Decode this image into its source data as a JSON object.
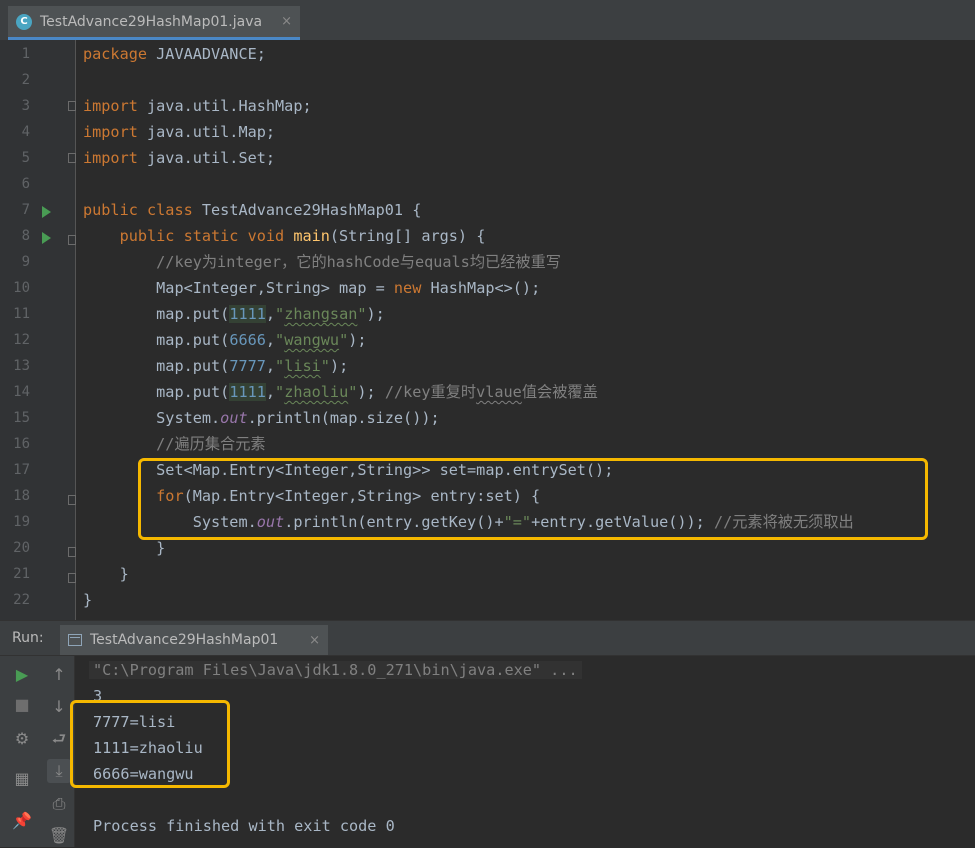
{
  "editor_tab": {
    "title": "TestAdvance29HashMap01.java",
    "icon": "class-icon",
    "close": "×"
  },
  "code": {
    "line_numbers": [
      "1",
      "2",
      "3",
      "4",
      "5",
      "6",
      "7",
      "8",
      "9",
      "10",
      "11",
      "12",
      "13",
      "14",
      "15",
      "16",
      "17",
      "18",
      "19",
      "20",
      "21",
      "22"
    ],
    "l1": {
      "kw": "package",
      "rest": " JAVAADVANCE;"
    },
    "l3": {
      "kw": "import",
      "rest": " java.util.HashMap;"
    },
    "l4": {
      "kw": "import",
      "rest": " java.util.Map;"
    },
    "l5": {
      "kw": "import",
      "rest": " java.util.Set;"
    },
    "l7": {
      "kw1": "public",
      "kw2": " class",
      "rest": " TestAdvance29HashMap01 {"
    },
    "l8": {
      "indent": "    ",
      "kw": "public static void",
      "fn": " main",
      "rest": "(String[] args) {"
    },
    "l9": {
      "indent": "        ",
      "comment": "//key为integer，它的hashCode与equals均已经被重写"
    },
    "l10": {
      "indent": "        ",
      "a": "Map<Integer,String> map = ",
      "kw": "new",
      "b": " HashMap<>();"
    },
    "l11": {
      "indent": "        ",
      "a": "map.put(",
      "num": "1111",
      "b": ",",
      "q1": "\"",
      "str": "zhangsan",
      "q2": "\"",
      "c": ");"
    },
    "l12": {
      "indent": "        ",
      "a": "map.put(",
      "num": "6666",
      "b": ",",
      "q1": "\"",
      "str": "wangwu",
      "q2": "\"",
      "c": ");"
    },
    "l13": {
      "indent": "        ",
      "a": "map.put(",
      "num": "7777",
      "b": ",",
      "q1": "\"",
      "str": "lisi",
      "q2": "\"",
      "c": ");"
    },
    "l14": {
      "indent": "        ",
      "a": "map.put(",
      "num": "1111",
      "b": ",",
      "q1": "\"",
      "str": "zhaoliu",
      "q2": "\"",
      "c": "); ",
      "comment1": "//key重复时",
      "comment_w": "vlaue",
      "comment2": "值会被覆盖"
    },
    "l15": {
      "indent": "        ",
      "a": "System.",
      "field": "out",
      "b": ".println(map.size());"
    },
    "l16": {
      "indent": "        ",
      "comment": "//遍历集合元素"
    },
    "l17": {
      "indent": "        ",
      "a": "Set<Map.Entry<Integer,String>> set=map.entrySet();"
    },
    "l18": {
      "indent": "        ",
      "kw": "for",
      "a": "(Map.Entry<Integer,String> entry:set) {"
    },
    "l19": {
      "indent": "            ",
      "a": "System.",
      "field": "out",
      "b": ".println(entry.getKey()+",
      "str": "\"=\"",
      "c": "+entry.getValue()); ",
      "comment": "//元素将被无须取出"
    },
    "l20": {
      "indent": "        ",
      "a": "}"
    },
    "l21": {
      "indent": "    ",
      "a": "}"
    },
    "l22": {
      "indent": "",
      "a": "}"
    }
  },
  "run_panel": {
    "label": "Run:",
    "tab_title": "TestAdvance29HashMap01",
    "tab_close": "×",
    "tools": {
      "rerun": "▶",
      "stop": "■",
      "debug": "⚙",
      "up": "↑",
      "down": "↓",
      "wrap": "⮐",
      "scroll": "⤓",
      "layout": "▦",
      "print": "⎙",
      "pin": "📌",
      "trash": "🗑"
    }
  },
  "console": {
    "cmd": "\"C:\\Program Files\\Java\\jdk1.8.0_271\\bin\\java.exe\" ...",
    "lines": [
      "3",
      "7777=lisi",
      "1111=zhaoliu",
      "6666=wangwu",
      "",
      "Process finished with exit code 0"
    ]
  },
  "colors": {
    "keyword": "#cc7832",
    "string": "#6a8759",
    "number": "#6897bb",
    "comment": "#808080",
    "function": "#ffc66d",
    "highlight": "#f5b800"
  }
}
